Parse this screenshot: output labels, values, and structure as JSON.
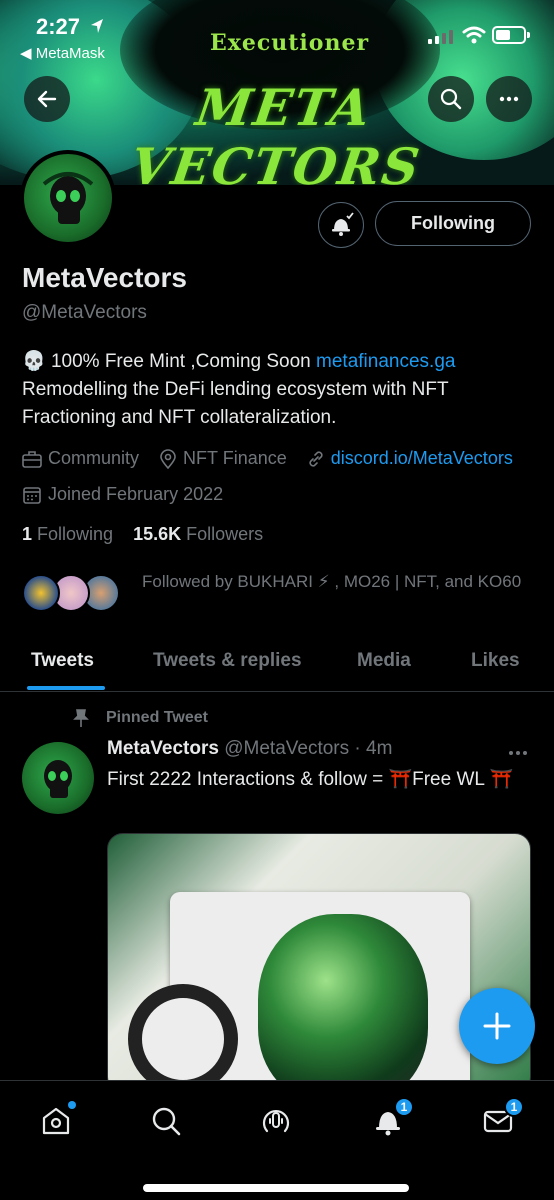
{
  "status_bar": {
    "time": "2:27",
    "back_app": "◀ MetaMask"
  },
  "banner": {
    "title": "META VECTORS",
    "subtitle": "Executioner"
  },
  "profile": {
    "name": "MetaVectors",
    "handle": "@MetaVectors",
    "bio_emoji": "💀",
    "bio_text_1": " 100% Free Mint ,Coming Soon ",
    "bio_link": "metafinances.ga",
    "bio_text_2": "Remodelling the DeFi lending ecosystem with NFT Fractioning and NFT collateralization.",
    "category": "Community",
    "location": "NFT Finance",
    "website": "discord.io/MetaVectors",
    "joined": "Joined February 2022",
    "following_count": "1",
    "following_label": "Following",
    "followers_count": "15.6K",
    "followers_label": "Followers",
    "followed_by": "Followed by BUKHARI ⚡ , MO26 | NFT, and KO60"
  },
  "actions": {
    "following_button": "Following"
  },
  "tabs": [
    {
      "label": "Tweets"
    },
    {
      "label": "Tweets & replies"
    },
    {
      "label": "Media"
    },
    {
      "label": "Likes"
    }
  ],
  "tweet": {
    "pinned_label": "Pinned Tweet",
    "author": "MetaVectors",
    "handle_time": "@MetaVectors · 4m",
    "text": "First 2222 Interactions & follow = ⛩️Free WL ⛩️"
  },
  "bottom_nav": {
    "notifications_badge": "1",
    "messages_badge": "1"
  },
  "colors": {
    "accent": "#1d9bf0",
    "background": "#000000",
    "muted": "#71767b"
  }
}
